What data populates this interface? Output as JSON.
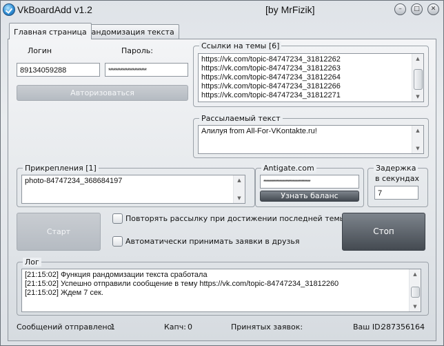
{
  "window": {
    "title": "VkBoardAdd  v1.2",
    "author": "[by MrFizik]",
    "controls": [
      "–",
      "□",
      "✕"
    ]
  },
  "tabs": [
    {
      "label": "Главная страница"
    },
    {
      "label": "Рандомизация текста"
    }
  ],
  "login": {
    "login_label": "Логин",
    "password_label": "Пароль:",
    "login_value": "89134059288",
    "password_value": "**********************",
    "auth_button": "Авторизоваться"
  },
  "topics": {
    "title": "Ссылки на темы [6]",
    "items": [
      "https://vk.com/topic-84747234_31812262",
      "https://vk.com/topic-84747234_31812263",
      "https://vk.com/topic-84747234_31812264",
      "https://vk.com/topic-84747234_31812266",
      "https://vk.com/topic-84747234_31812271"
    ]
  },
  "message": {
    "title": "Рассылаемый текст",
    "text": "Алилуя from All-For-VKontakte.ru!"
  },
  "attachments": {
    "title": "Прикрепления [1]",
    "text": "photo-84747234_368684197"
  },
  "antigate": {
    "title": "Antigate.com",
    "key": "********************************",
    "balance_button": "Узнать баланс"
  },
  "delay": {
    "title_line1": "Задержка",
    "title_line2": "в секундах",
    "value": "7"
  },
  "actions": {
    "start": "Старт",
    "stop": "Стоп",
    "repeat_label": "Повторять рассылку при достижении последней темы",
    "auto_accept_label": "Автоматически принимать заявки в друзья"
  },
  "log": {
    "title": "Лог",
    "lines": [
      "[21:15:02] Функция рандомизации текста сработала",
      "[21:15:02] Успешно отправили сообщение в тему https://vk.com/topic-84747234_31812260",
      "[21:15:02] Ждем 7 сек."
    ]
  },
  "status": {
    "sent_label": "Сообщений отправлено:",
    "sent_value": "1",
    "captcha_label": "Капч:",
    "captcha_value": "0",
    "accepted_label": "Принятых заявок:",
    "id_label": "Ваш ID:",
    "id_value": "287356164"
  }
}
